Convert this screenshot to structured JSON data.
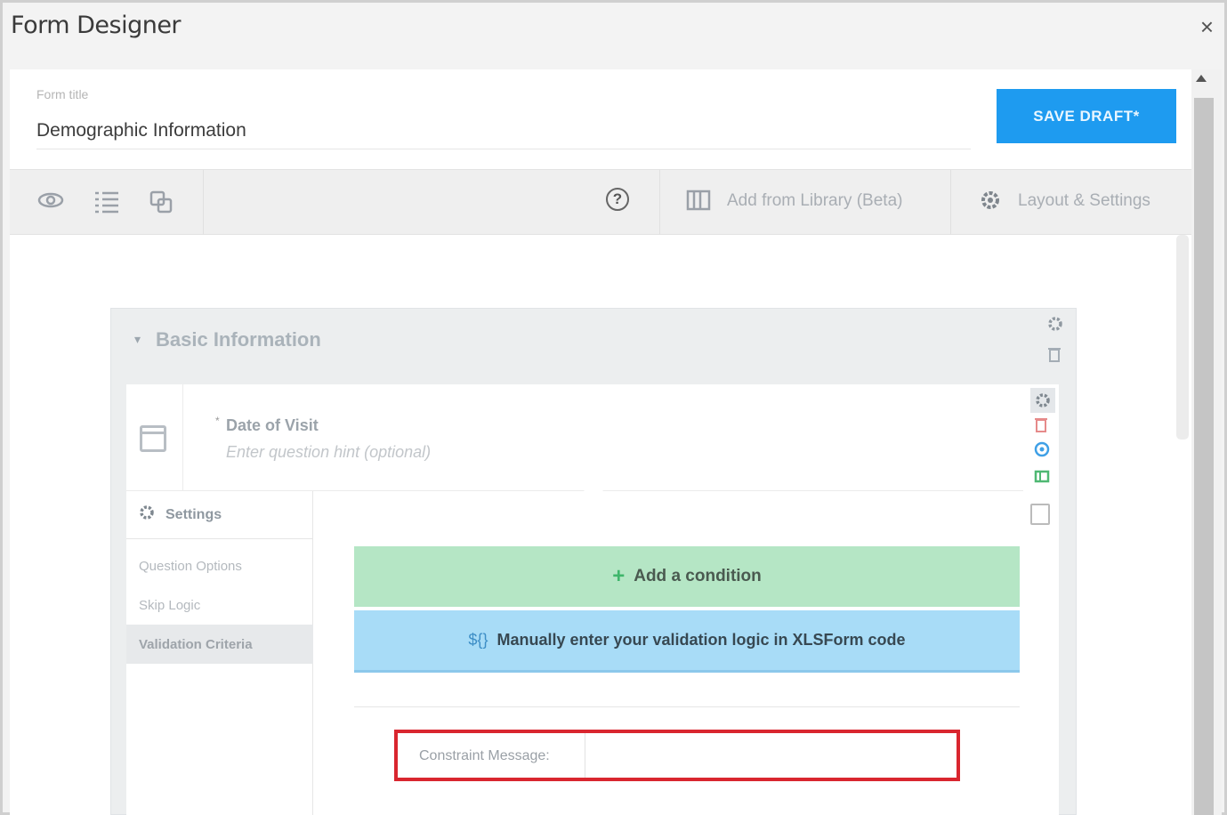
{
  "window": {
    "title": "Form Designer",
    "close_label": "×"
  },
  "header": {
    "form_title_label": "Form title",
    "form_title_value": "Demographic Information",
    "save_label": "SAVE DRAFT*"
  },
  "toolbar": {
    "add_from_library_label": "Add from Library (Beta)",
    "layout_settings_label": "Layout & Settings",
    "help_label": "?"
  },
  "group": {
    "title": "Basic Information",
    "caret": "▾"
  },
  "question": {
    "required_marker": "*",
    "label": "Date of Visit",
    "hint_placeholder": "Enter question hint (optional)"
  },
  "settings": {
    "title": "Settings",
    "items": [
      {
        "label": "Question Options"
      },
      {
        "label": "Skip Logic"
      },
      {
        "label": "Validation Criteria"
      }
    ]
  },
  "validation": {
    "add_condition_label": "Add a condition",
    "add_condition_icon": "+",
    "manual_icon": "${}",
    "manual_label": "Manually enter your validation logic in XLSForm code",
    "constraint_message_label": "Constraint Message:",
    "constraint_message_value": ""
  },
  "colors": {
    "save_button": "#1e9bf0",
    "add_condition_bg": "#b5e6c5",
    "manual_bg": "#a8dcf7",
    "highlight_border": "#d9262f"
  }
}
